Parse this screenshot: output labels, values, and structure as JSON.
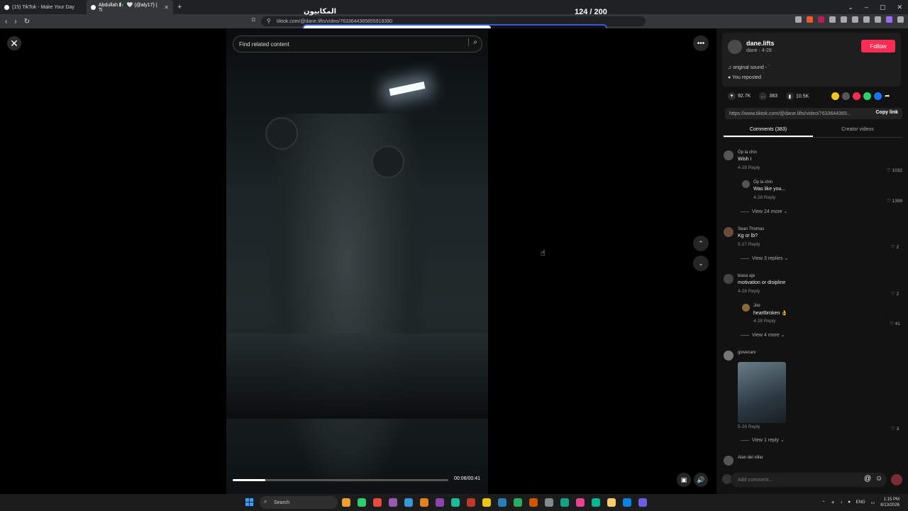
{
  "browser": {
    "tabs": [
      {
        "label": "(15) TikTok - Make Your Day"
      },
      {
        "label": "Abdullah 🇵🇰 🤍 (@aly17) | Ti"
      }
    ],
    "url": "tiktok.com/@dane.lifts/video/7633644365855919390"
  },
  "overlay": {
    "title": "المكابيون",
    "count": "124 / 200",
    "progress_percent": 62
  },
  "search": {
    "placeholder": "Find related content"
  },
  "video": {
    "time": "00:06/00:41",
    "seek_percent": 15
  },
  "author": {
    "username": "dane.lifts",
    "subtitle": "dane · 4-28",
    "follow_label": "Follow",
    "sound": "original sound - `",
    "reposted": "You reposted"
  },
  "stats": {
    "likes": "92.7K",
    "comments": "383",
    "saves": "10.5K"
  },
  "share": {
    "link": "https://www.tiktok.com/@dane.lifts/video/7633644365...",
    "copy_label": "Copy link",
    "colors": [
      "#f5c518",
      "#555555",
      "#fe2c55",
      "#25d366",
      "#1877f2"
    ]
  },
  "panel_tabs": {
    "comments": "Comments (383)",
    "creator": "Creator videos"
  },
  "comments": [
    {
      "name": "Óp la chin",
      "text": "Wish i",
      "meta": "4-28   Reply",
      "likes": "1032"
    },
    {
      "name": "Óp la chin",
      "text": "Was like you...",
      "meta": "4-28   Reply",
      "likes": "1399"
    },
    {
      "name": "Sean Thomas",
      "text": "Kg or lb?",
      "meta": "5-27   Reply",
      "likes": "2"
    },
    {
      "name": "biasa aja",
      "text": "motivation or disipline",
      "meta": "4-28   Reply",
      "likes": "2"
    },
    {
      "name": "Joe",
      "text": "heartbroken 👌",
      "meta": "4-28   Reply",
      "likes": "41"
    },
    {
      "name": "giovecarv",
      "text": "",
      "meta": "5-26   Reply",
      "likes": "3"
    },
    {
      "name": "Alan del villar",
      "text": "",
      "meta": "",
      "likes": ""
    }
  ],
  "view_more": {
    "first": "View 24 more",
    "second": "View 3 replies",
    "third": "View 4 more",
    "fourth": "View 1 reply"
  },
  "comment_input": {
    "placeholder": "Add comment..."
  },
  "taskbar": {
    "search_label": "Search",
    "lang": "ENG",
    "time": "1:15 PM",
    "date": "8/13/2026",
    "app_colors": [
      "#f0a030",
      "#2ecc71",
      "#e74c3c",
      "#9b59b6",
      "#3498db",
      "#e67e22",
      "#8e44ad",
      "#1abc9c",
      "#c0392b",
      "#f1c40f",
      "#2980b9",
      "#27ae60",
      "#d35400",
      "#7f8c8d",
      "#16a085",
      "#e84393",
      "#00b894",
      "#fdcb6e",
      "#0984e3",
      "#6c5ce7"
    ]
  }
}
